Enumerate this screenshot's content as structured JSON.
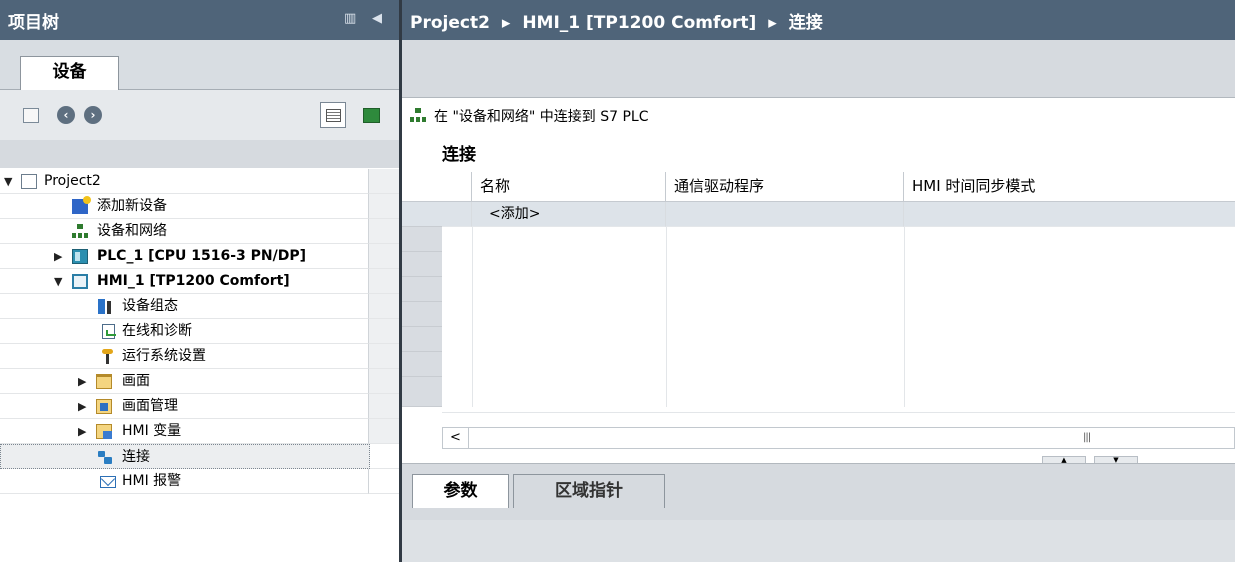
{
  "project_tree": {
    "title": "项目树",
    "tab_label": "设备",
    "items": [
      {
        "label": "Project2",
        "level": 0,
        "expanded": true,
        "icon": "project-icon"
      },
      {
        "label": "添加新设备",
        "level": 1,
        "icon": "add-device-icon"
      },
      {
        "label": "设备和网络",
        "level": 1,
        "icon": "network-icon"
      },
      {
        "label": "PLC_1 [CPU 1516-3 PN/DP]",
        "level": 1,
        "expanded": false,
        "icon": "plc-icon"
      },
      {
        "label": "HMI_1 [TP1200 Comfort]",
        "level": 1,
        "expanded": true,
        "icon": "hmi-icon"
      },
      {
        "label": "设备组态",
        "level": 2,
        "icon": "device-config-icon"
      },
      {
        "label": "在线和诊断",
        "level": 2,
        "icon": "diagnostics-icon"
      },
      {
        "label": "运行系统设置",
        "level": 2,
        "icon": "runtime-settings-icon"
      },
      {
        "label": "画面",
        "level": 2,
        "expanded": false,
        "icon": "screens-folder-icon"
      },
      {
        "label": "画面管理",
        "level": 2,
        "expanded": false,
        "icon": "screen-management-icon"
      },
      {
        "label": "HMI 变量",
        "level": 2,
        "expanded": false,
        "icon": "hmi-tags-icon"
      },
      {
        "label": "连接",
        "level": 2,
        "selected": true,
        "icon": "connections-icon"
      },
      {
        "label": "HMI 报警",
        "level": 2,
        "icon": "hmi-alarms-icon"
      }
    ]
  },
  "editor": {
    "breadcrumb": [
      "Project2",
      "HMI_1 [TP1200 Comfort]",
      "连接"
    ],
    "breadcrumb_sep": "▸",
    "toolbar_text": "在 \"设备和网络\" 中连接到 S7 PLC",
    "section_title": "连接",
    "columns": [
      "名称",
      "通信驱动程序",
      "HMI 时间同步模式"
    ],
    "add_row_label": "<添加>",
    "bottom_tabs": [
      "参数",
      "区域指针"
    ]
  },
  "colors": {
    "title_bar": "#4f6479",
    "toolbar_bg": "#d6dadf",
    "selected_row": "#dde3e9"
  }
}
